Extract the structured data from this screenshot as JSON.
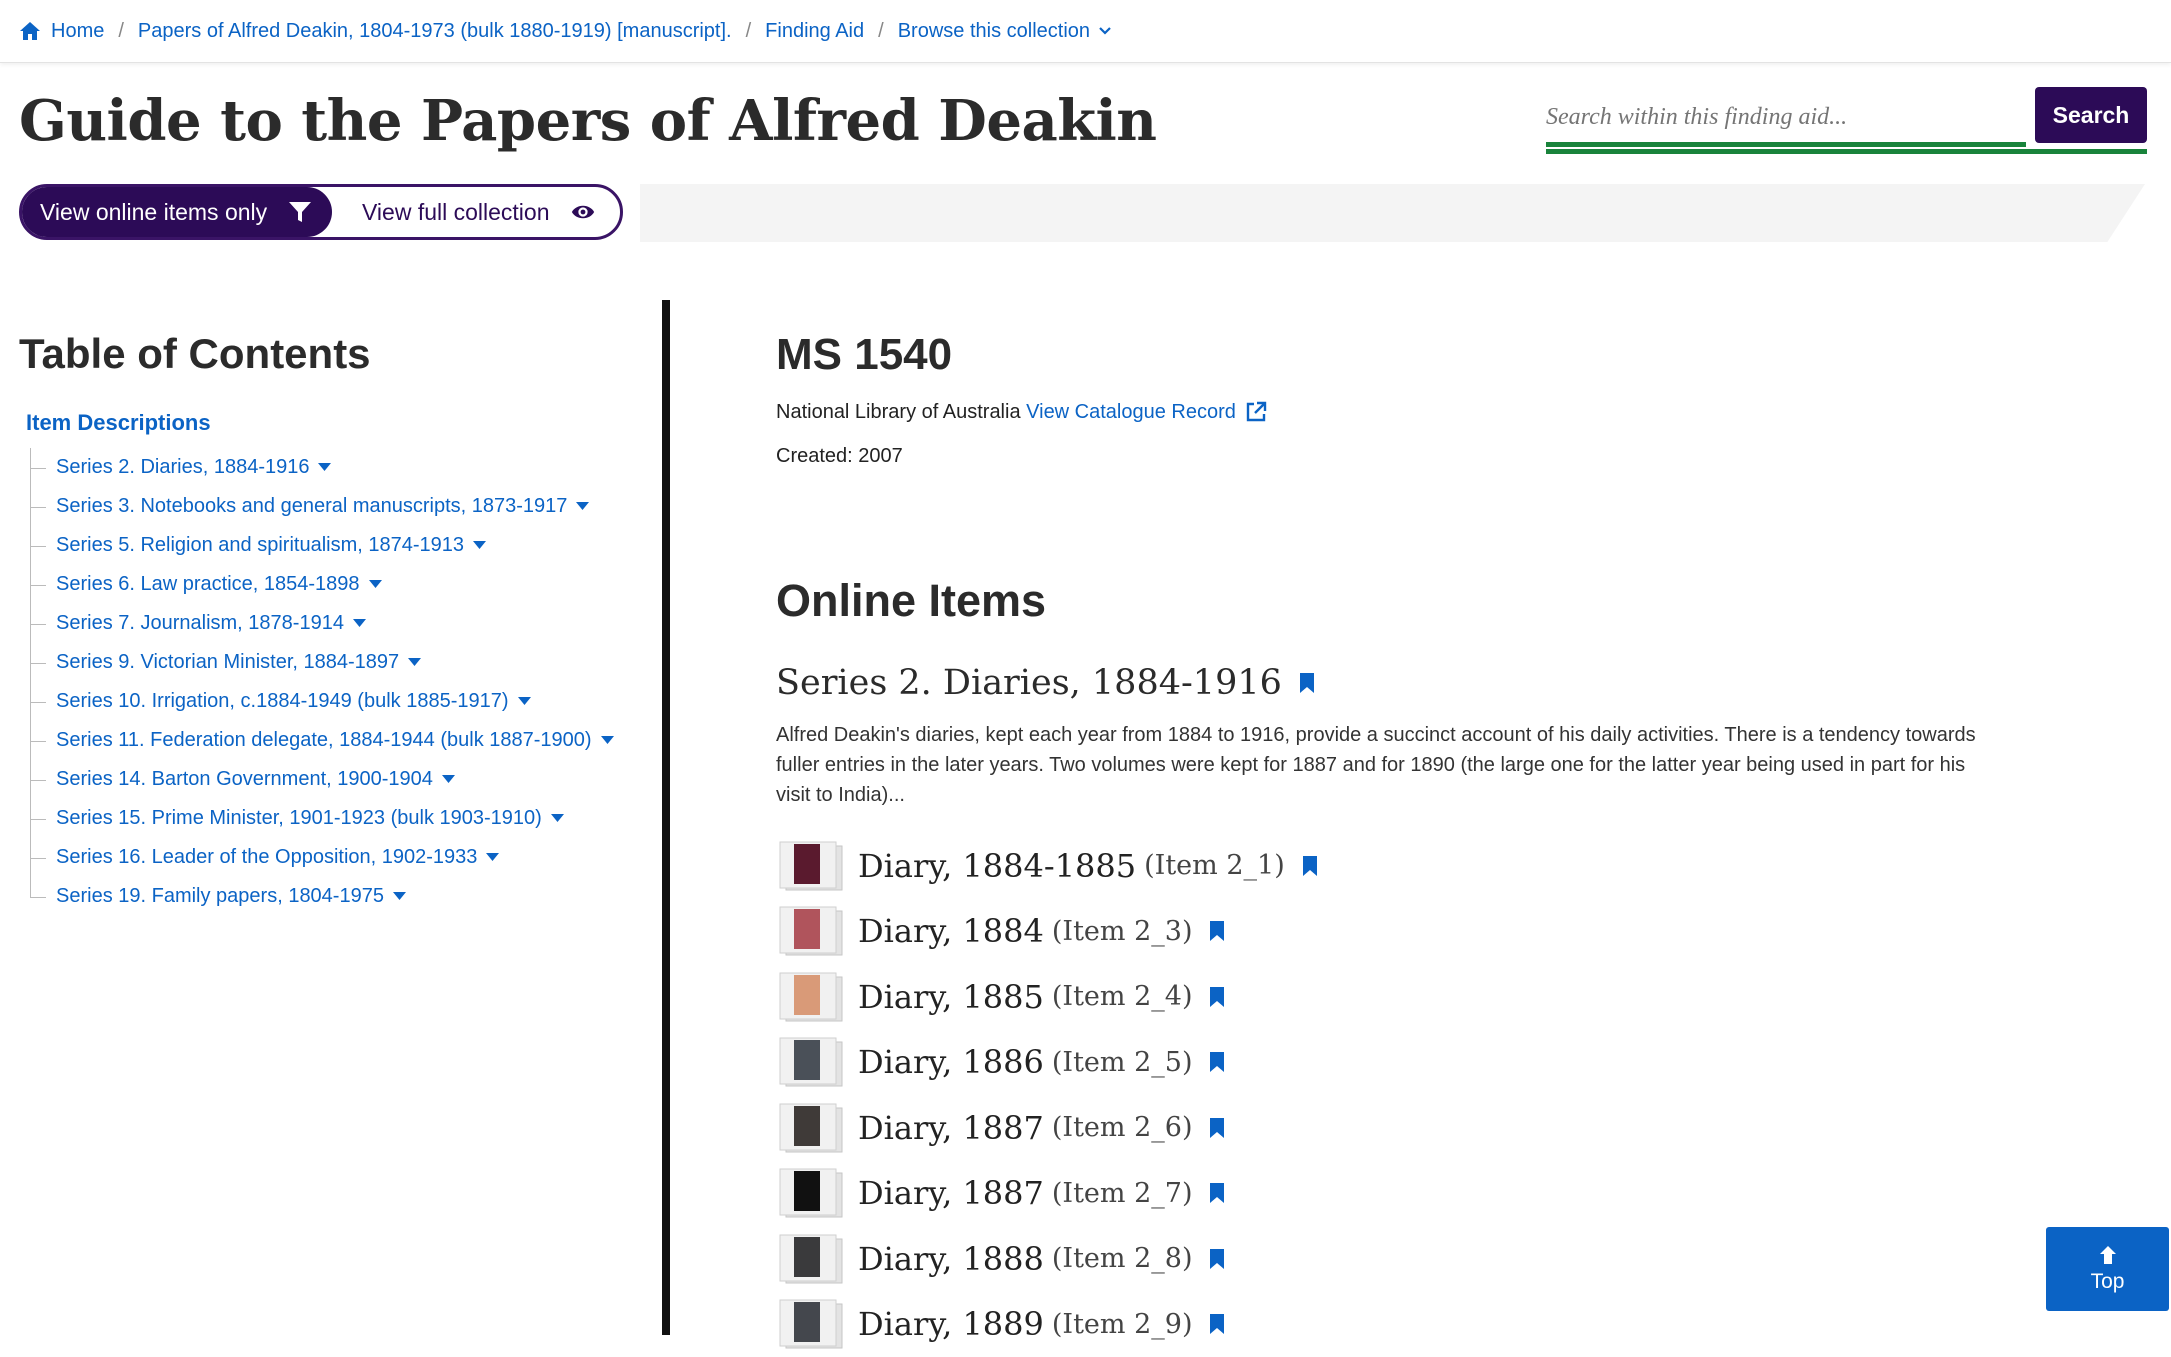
{
  "breadcrumb": {
    "items": [
      {
        "label": "Home"
      },
      {
        "label": "Papers of Alfred Deakin, 1804-1973 (bulk 1880-1919) [manuscript]."
      },
      {
        "label": "Finding Aid"
      },
      {
        "label": "Browse this collection"
      }
    ],
    "separator": "/"
  },
  "page": {
    "title": "Guide to the Papers of Alfred Deakin"
  },
  "search": {
    "placeholder": "Search within this finding aid...",
    "button_label": "Search"
  },
  "view_toggle": {
    "online_label": "View online items only",
    "full_label": "View full collection"
  },
  "toc": {
    "title": "Table of Contents",
    "root_label": "Item Descriptions",
    "items": [
      {
        "label": "Series 2. Diaries, 1884-1916"
      },
      {
        "label": "Series 3. Notebooks and general manuscripts, 1873-1917"
      },
      {
        "label": "Series 5. Religion and spiritualism, 1874-1913"
      },
      {
        "label": "Series 6. Law practice, 1854-1898"
      },
      {
        "label": "Series 7. Journalism, 1878-1914"
      },
      {
        "label": "Series 9. Victorian Minister, 1884-1897"
      },
      {
        "label": "Series 10. Irrigation, c.1884-1949 (bulk 1885-1917)"
      },
      {
        "label": "Series 11. Federation delegate, 1884-1944 (bulk 1887-1900)"
      },
      {
        "label": "Series 14. Barton Government, 1900-1904"
      },
      {
        "label": "Series 15. Prime Minister, 1901-1923 (bulk 1903-1910)"
      },
      {
        "label": "Series 16. Leader of the Opposition, 1902-1933"
      },
      {
        "label": "Series 19. Family papers, 1804-1975"
      }
    ]
  },
  "record": {
    "ms_number": "MS 1540",
    "library": "National Library of Australia",
    "catalogue_link": "View Catalogue Record",
    "created": "Created: 2007"
  },
  "online_items": {
    "title": "Online Items",
    "series_title": "Series 2. Diaries, 1884-1916",
    "series_description": "Alfred Deakin's diaries, kept each year from 1884 to 1916, provide a succinct account of his daily activities. There is a tendency towards fuller entries in the later years. Two volumes were kept for 1887 and for 1890 (the large one for the latter year being used in part for his visit to India)...",
    "items": [
      {
        "title": "Diary, 1884-1885",
        "ref": "(Item 2_1)",
        "cover": "#5a1a2e"
      },
      {
        "title": "Diary, 1884",
        "ref": "(Item 2_3)",
        "cover": "#b0545c"
      },
      {
        "title": "Diary, 1885",
        "ref": "(Item 2_4)",
        "cover": "#d99a78"
      },
      {
        "title": "Diary, 1886",
        "ref": "(Item 2_5)",
        "cover": "#4a5058"
      },
      {
        "title": "Diary, 1887",
        "ref": "(Item 2_6)",
        "cover": "#3f3a38"
      },
      {
        "title": "Diary, 1887",
        "ref": "(Item 2_7)",
        "cover": "#111111"
      },
      {
        "title": "Diary, 1888",
        "ref": "(Item 2_8)",
        "cover": "#3a3a3c"
      },
      {
        "title": "Diary, 1889",
        "ref": "(Item 2_9)",
        "cover": "#44474d"
      }
    ]
  },
  "top_button": {
    "label": "Top"
  },
  "colors": {
    "link": "#0b63c5",
    "brand_purple": "#2c0b57",
    "search_underline": "#19833b"
  }
}
